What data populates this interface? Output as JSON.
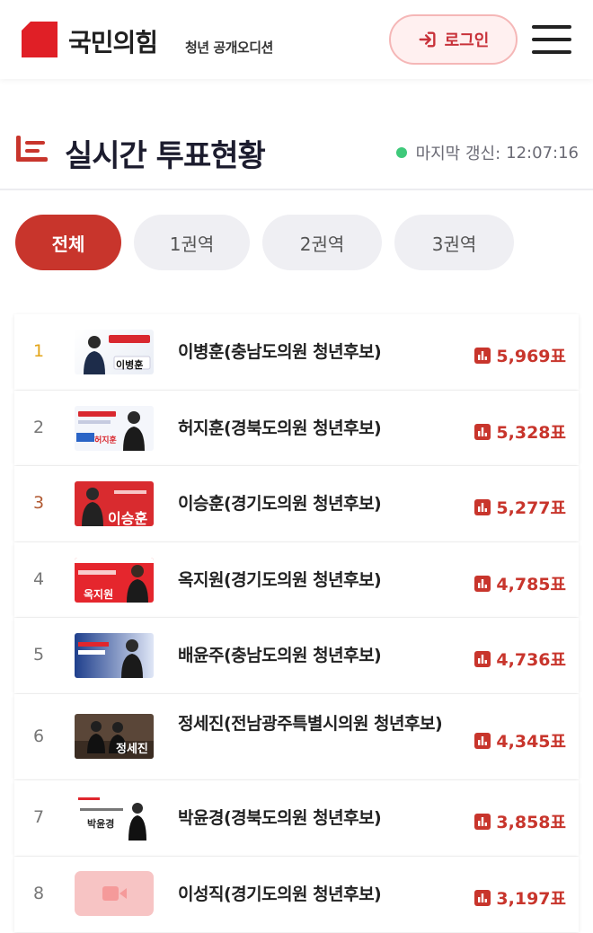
{
  "header": {
    "logo_text": "국민의힘",
    "logo_sub": "청년 공개오디션",
    "login_label": "로그인",
    "brand_color": "#e01f26"
  },
  "section": {
    "title": "실시간 투표현황",
    "update_label": "마지막 갱신:",
    "update_time": "12:07:16",
    "status_color": "#3ec97a"
  },
  "tabs": [
    {
      "label": "전체",
      "active": true
    },
    {
      "label": "1권역",
      "active": false
    },
    {
      "label": "2권역",
      "active": false
    },
    {
      "label": "3권역",
      "active": false
    }
  ],
  "candidates": [
    {
      "rank": "1",
      "name": "이병훈(충남도의원 청년후보)",
      "votes": "5,969표",
      "thumb_text": "이병훈"
    },
    {
      "rank": "2",
      "name": "허지훈(경북도의원 청년후보)",
      "votes": "5,328표",
      "thumb_text": "허지훈"
    },
    {
      "rank": "3",
      "name": "이승훈(경기도의원 청년후보)",
      "votes": "5,277표",
      "thumb_text": "이승훈"
    },
    {
      "rank": "4",
      "name": "옥지원(경기도의원 청년후보)",
      "votes": "4,785표",
      "thumb_text": "옥지원"
    },
    {
      "rank": "5",
      "name": "배윤주(충남도의원 청년후보)",
      "votes": "4,736표",
      "thumb_text": ""
    },
    {
      "rank": "6",
      "name": "정세진(전남광주특별시의원 청년후보)",
      "votes": "4,345표",
      "thumb_text": "정세진"
    },
    {
      "rank": "7",
      "name": "박윤경(경북도의원 청년후보)",
      "votes": "3,858표",
      "thumb_text": "박윤경"
    },
    {
      "rank": "8",
      "name": "이성직(경기도의원 청년후보)",
      "votes": "3,197표",
      "thumb_text": ""
    }
  ]
}
